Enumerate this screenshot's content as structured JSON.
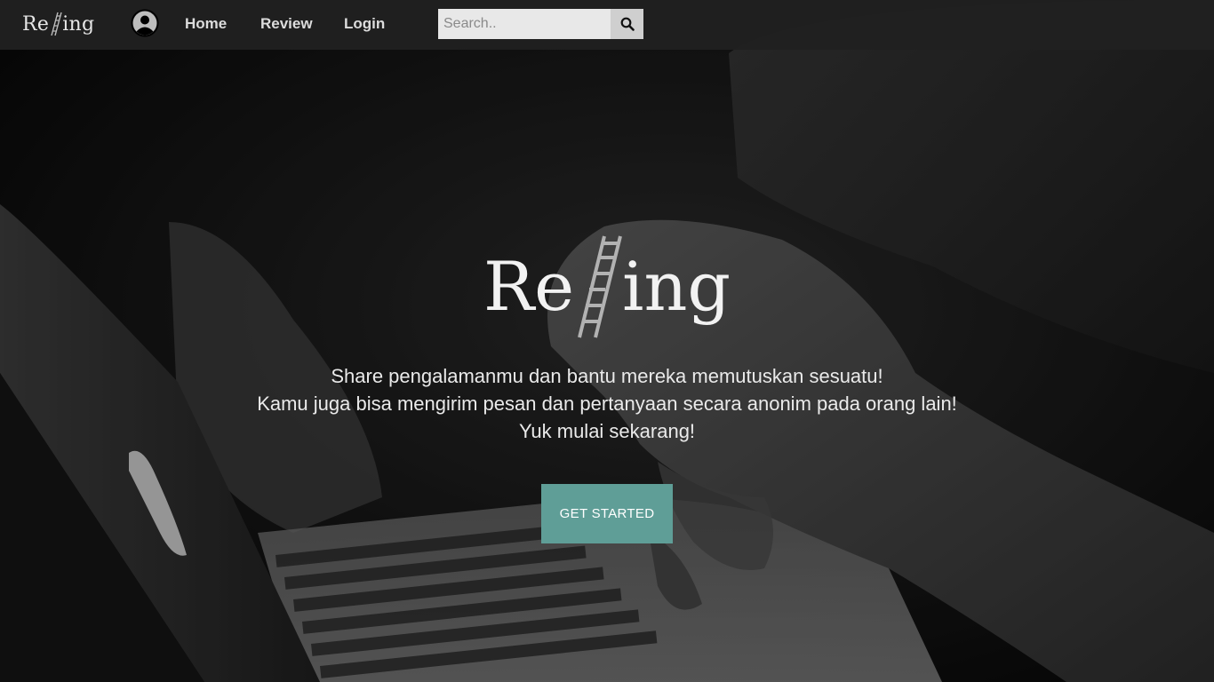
{
  "navbar": {
    "logo_left": "Re",
    "logo_right": "ing",
    "links": {
      "home": "Home",
      "review": "Review",
      "login": "Login"
    },
    "search": {
      "placeholder": "Search..",
      "value": ""
    }
  },
  "hero": {
    "title_left": "Re",
    "title_right": "ing",
    "tagline": [
      "Share pengalamanmu dan bantu mereka memutuskan sesuatu!",
      "Kamu juga bisa mengirim pesan dan pertanyaan secara anonim pada orang lain!",
      "Yuk mulai sekarang!"
    ],
    "cta_label": "GET STARTED"
  },
  "icons": {
    "logo": "ladder-icon",
    "account": "user-circle-icon",
    "search": "magnifier-icon"
  },
  "colors": {
    "navbar_bg": "#202020",
    "cta_bg": "#5f9e97",
    "text_light": "#f2f2f2"
  }
}
